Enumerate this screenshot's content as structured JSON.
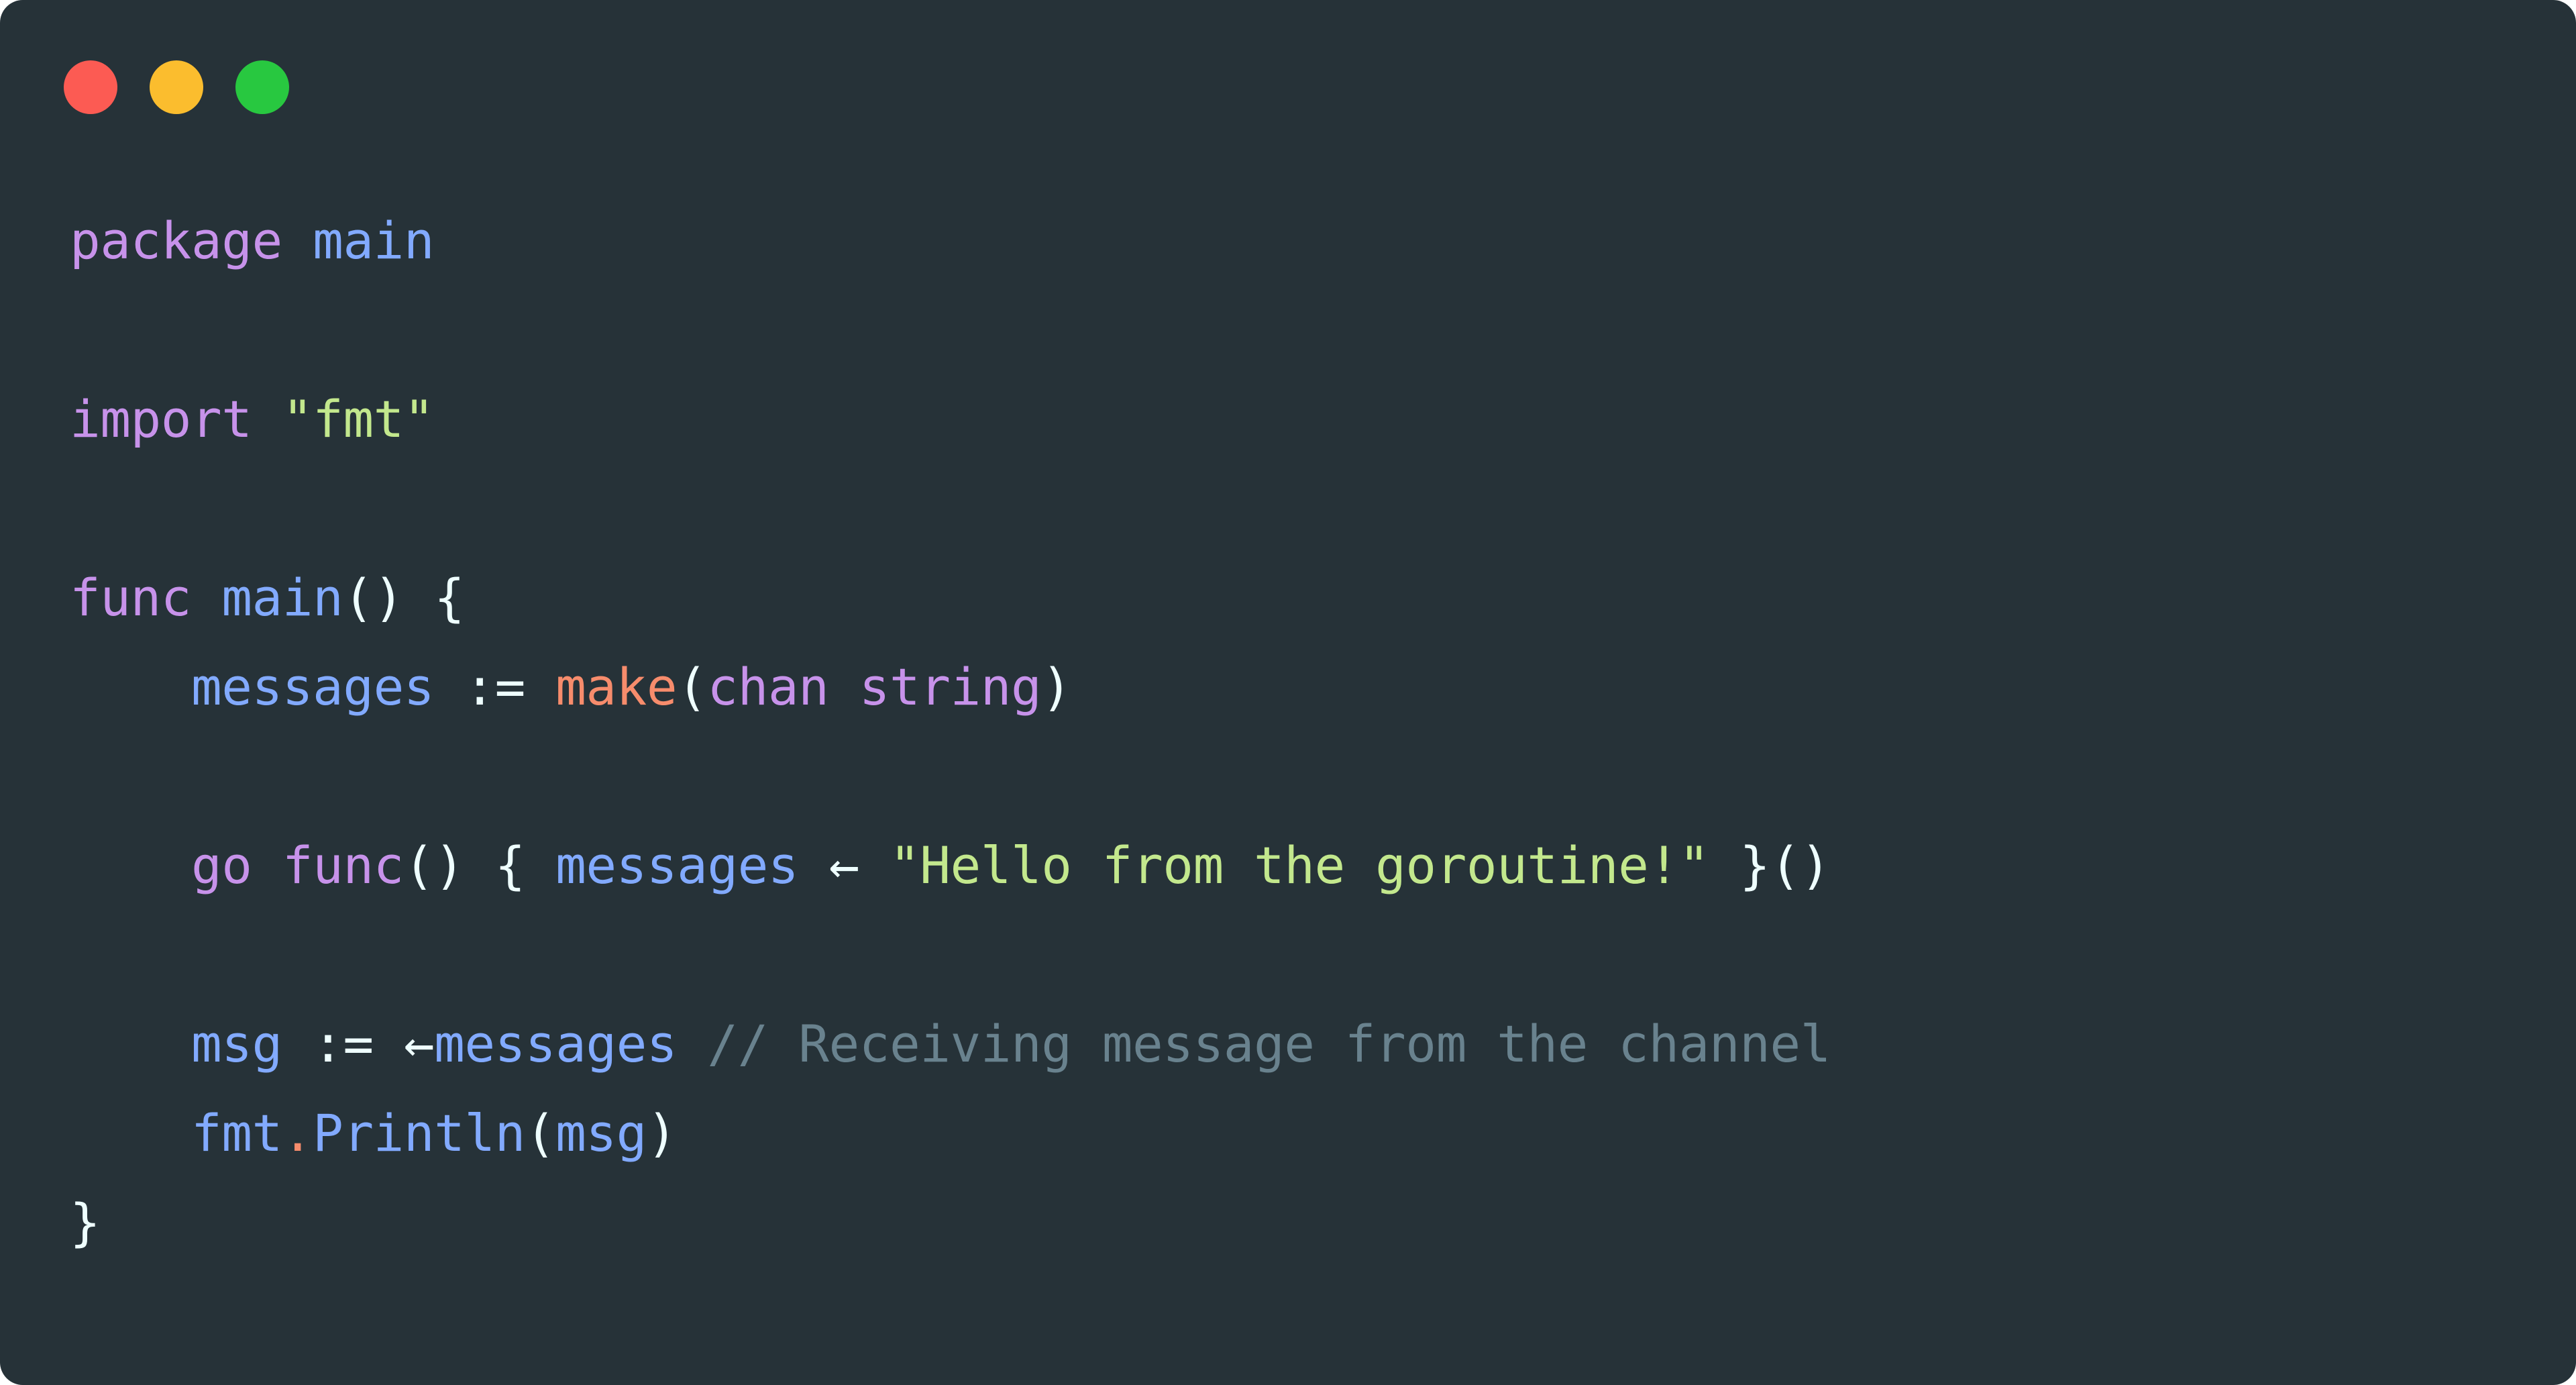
{
  "window": {
    "background_color": "#263238",
    "corner_radius_px": 34,
    "traffic_lights": [
      {
        "name": "close",
        "color": "#fc5b53"
      },
      {
        "name": "minimize",
        "color": "#fbbd2e"
      },
      {
        "name": "maximize",
        "color": "#28c840"
      }
    ]
  },
  "theme": {
    "keyword_color": "#c792ea",
    "identifier_color": "#82aaff",
    "string_color": "#c3e88d",
    "builtin_color": "#f78c6c",
    "punctuation_color": "#eeffff",
    "comment_color": "#69828e"
  },
  "code": {
    "language": "Go",
    "plain_text": "package main\n\nimport \"fmt\"\n\nfunc main() {\n    messages := make(chan string)\n\n    go func() { messages <- \"Hello from the goroutine!\" }()\n\n    msg := <-messages // Receiving message from the channel\n    fmt.Println(msg)\n}",
    "lines": [
      {
        "index": 1,
        "text": "package main",
        "tokens": [
          {
            "t": "package",
            "k": "kw"
          },
          {
            "t": " ",
            "k": "op"
          },
          {
            "t": "main",
            "k": "id"
          }
        ]
      },
      {
        "index": 2,
        "text": "",
        "tokens": []
      },
      {
        "index": 3,
        "text": "import \"fmt\"",
        "tokens": [
          {
            "t": "import",
            "k": "kw"
          },
          {
            "t": " ",
            "k": "op"
          },
          {
            "t": "\"fmt\"",
            "k": "str"
          }
        ]
      },
      {
        "index": 4,
        "text": "",
        "tokens": []
      },
      {
        "index": 5,
        "text": "func main() {",
        "tokens": [
          {
            "t": "func",
            "k": "kw"
          },
          {
            "t": " ",
            "k": "op"
          },
          {
            "t": "main",
            "k": "id"
          },
          {
            "t": "() {",
            "k": "op"
          }
        ]
      },
      {
        "index": 6,
        "text": "    messages := make(chan string)",
        "tokens": [
          {
            "t": "    ",
            "k": "op"
          },
          {
            "t": "messages",
            "k": "id"
          },
          {
            "t": " := ",
            "k": "op"
          },
          {
            "t": "make",
            "k": "fn"
          },
          {
            "t": "(",
            "k": "op"
          },
          {
            "t": "chan",
            "k": "kw"
          },
          {
            "t": " ",
            "k": "op"
          },
          {
            "t": "string",
            "k": "kw"
          },
          {
            "t": ")",
            "k": "op"
          }
        ]
      },
      {
        "index": 7,
        "text": "",
        "tokens": []
      },
      {
        "index": 8,
        "text": "    go func() { messages <- \"Hello from the goroutine!\" }()",
        "tokens": [
          {
            "t": "    ",
            "k": "op"
          },
          {
            "t": "go",
            "k": "kw"
          },
          {
            "t": " ",
            "k": "op"
          },
          {
            "t": "func",
            "k": "kw"
          },
          {
            "t": "() { ",
            "k": "op"
          },
          {
            "t": "messages",
            "k": "id"
          },
          {
            "t": " ",
            "k": "op"
          },
          {
            "t": "←",
            "k": "arrow"
          },
          {
            "t": " ",
            "k": "op"
          },
          {
            "t": "\"Hello from the goroutine!\"",
            "k": "str"
          },
          {
            "t": " }()",
            "k": "op"
          }
        ]
      },
      {
        "index": 9,
        "text": "",
        "tokens": []
      },
      {
        "index": 10,
        "text": "    msg := <-messages // Receiving message from the channel",
        "tokens": [
          {
            "t": "    ",
            "k": "op"
          },
          {
            "t": "msg",
            "k": "id"
          },
          {
            "t": " := ",
            "k": "op"
          },
          {
            "t": "←",
            "k": "arrow"
          },
          {
            "t": "messages",
            "k": "id"
          },
          {
            "t": " ",
            "k": "op"
          },
          {
            "t": "// Receiving message from the channel",
            "k": "cmt"
          }
        ]
      },
      {
        "index": 11,
        "text": "    fmt.Println(msg)",
        "tokens": [
          {
            "t": "    ",
            "k": "op"
          },
          {
            "t": "fmt",
            "k": "id"
          },
          {
            "t": ".",
            "k": "fn"
          },
          {
            "t": "Println",
            "k": "id"
          },
          {
            "t": "(",
            "k": "op"
          },
          {
            "t": "msg",
            "k": "id"
          },
          {
            "t": ")",
            "k": "op"
          }
        ]
      },
      {
        "index": 12,
        "text": "}",
        "tokens": [
          {
            "t": "}",
            "k": "op"
          }
        ]
      }
    ]
  }
}
